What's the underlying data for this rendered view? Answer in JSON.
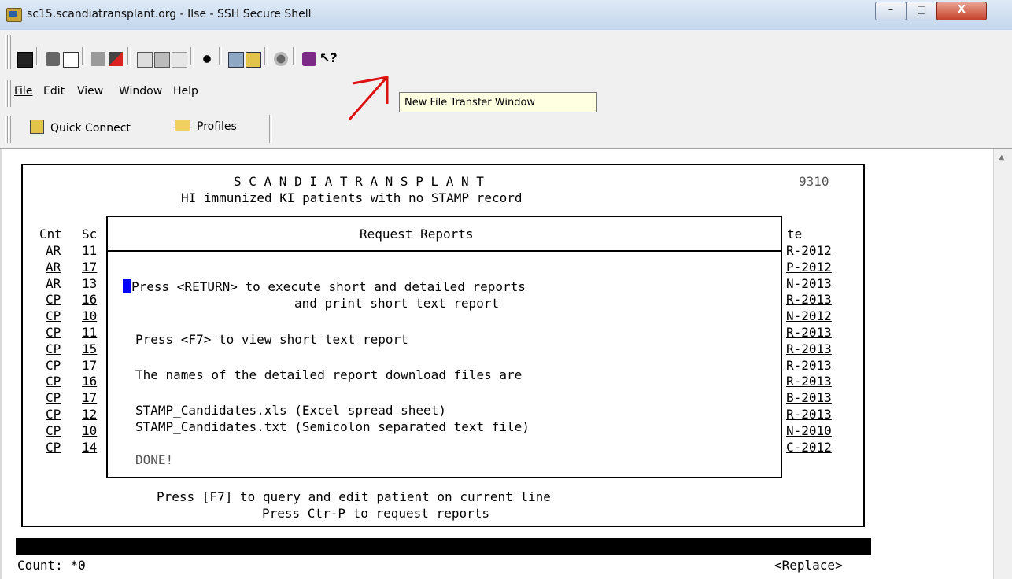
{
  "window": {
    "title": "sc15.scandiatransplant.org - Ilse - SSH Secure Shell",
    "controls": {
      "minimize": "–",
      "maximize": "□",
      "close": "X"
    }
  },
  "toolbar": {
    "icons": [
      "save-icon",
      "print-icon",
      "print-preview-icon",
      "disconnect-icon",
      "edit-profile-icon",
      "copy-icon",
      "paste-icon",
      "paste-disabled-icon",
      "find-icon",
      "new-terminal-window-icon",
      "new-file-transfer-window-icon",
      "settings-icon",
      "help-book-icon",
      "context-help-icon"
    ]
  },
  "menu": {
    "items": [
      {
        "label": "File",
        "mnemonic": "F"
      },
      {
        "label": "Edit",
        "mnemonic": "E"
      },
      {
        "label": "View",
        "mnemonic": "V"
      },
      {
        "label": "Window",
        "mnemonic": "W"
      },
      {
        "label": "Help",
        "mnemonic": "H"
      }
    ]
  },
  "quickbar": {
    "quick_connect": "Quick Connect",
    "profiles": "Profiles"
  },
  "tooltip": "New File Transfer Window",
  "terminal": {
    "header": {
      "title": "S C A N D I A T R A N S P L A N T",
      "code": "9310",
      "subtitle": "HI immunized KI patients with no STAMP record"
    },
    "columns": {
      "cnt": "Cnt",
      "sc": "Sc",
      "date": "te"
    },
    "rows": [
      {
        "cnt": "AR",
        "sc": "11",
        "date": "R-2012"
      },
      {
        "cnt": "AR",
        "sc": "17",
        "date": "P-2012"
      },
      {
        "cnt": "AR",
        "sc": "13",
        "date": "N-2013"
      },
      {
        "cnt": "CP",
        "sc": "16",
        "date": "R-2013"
      },
      {
        "cnt": "CP",
        "sc": "10",
        "date": "N-2012"
      },
      {
        "cnt": "CP",
        "sc": "11",
        "date": "R-2013"
      },
      {
        "cnt": "CP",
        "sc": "15",
        "date": "R-2013"
      },
      {
        "cnt": "CP",
        "sc": "17",
        "date": "R-2013"
      },
      {
        "cnt": "CP",
        "sc": "16",
        "date": "R-2013"
      },
      {
        "cnt": "CP",
        "sc": "17",
        "date": "B-2013"
      },
      {
        "cnt": "CP",
        "sc": "12",
        "date": "R-2013"
      },
      {
        "cnt": "CP",
        "sc": "10",
        "date": "N-2010"
      },
      {
        "cnt": "CP",
        "sc": "14",
        "date": "C-2012"
      }
    ],
    "dialog": {
      "title": "Request Reports",
      "line1": "Press <RETURN> to execute short and detailed reports",
      "line2": "and print short text report",
      "line3": "Press <F7> to view short text report",
      "line4": "The names of the detailed report download files are",
      "line5": "STAMP_Candidates.xls (Excel spread sheet)",
      "line6": "STAMP_Candidates.txt (Semicolon separated text file)",
      "status": "DONE!"
    },
    "footer": {
      "line1": "Press [F7] to query and edit patient on current line",
      "line2": "Press Ctr-P to request reports"
    },
    "status_left": "Count: *0",
    "status_right": "<Replace>"
  }
}
